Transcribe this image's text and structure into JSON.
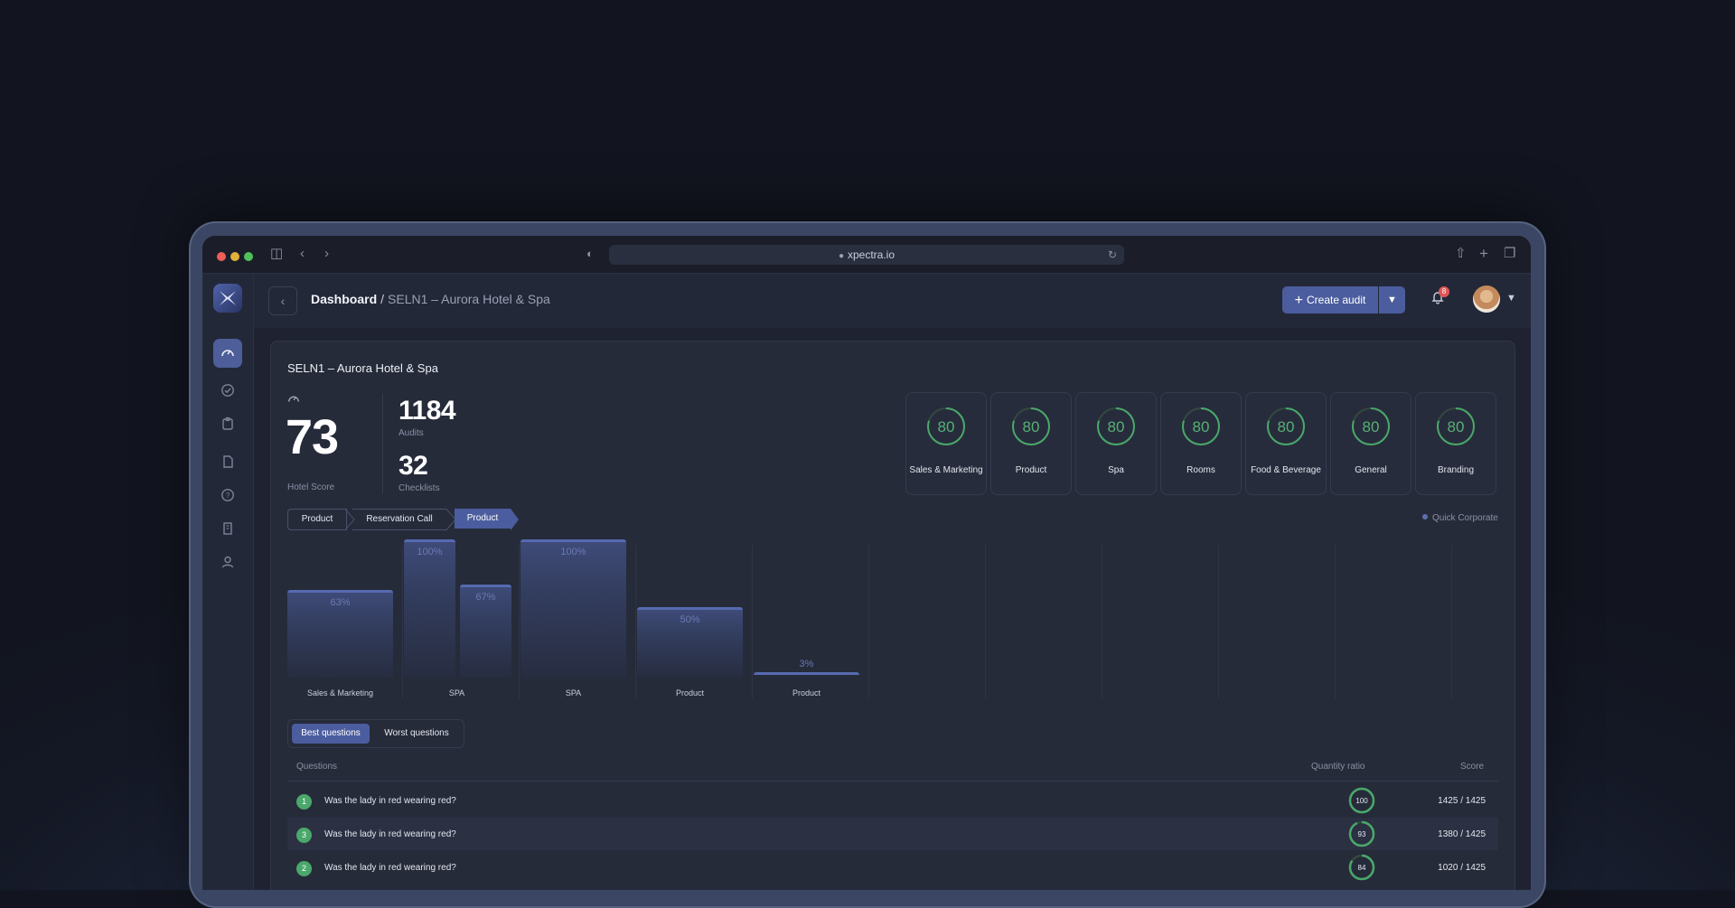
{
  "browser": {
    "url": "xpectra.io"
  },
  "breadcrumb": {
    "root": "Dashboard",
    "separator": "/",
    "current": "SELN1 – Aurora Hotel & Spa"
  },
  "header": {
    "create_label": "Create audit",
    "notification_count": "8"
  },
  "card": {
    "title": "SELN1 – Aurora Hotel & Spa",
    "hotel_score": "73",
    "hotel_score_label": "Hotel Score",
    "audits": "1184",
    "audits_label": "Audits",
    "checklists": "32",
    "checklists_label": "Checklists"
  },
  "categories": [
    {
      "name": "Sales & Marketing",
      "value": "80"
    },
    {
      "name": "Product",
      "value": "80"
    },
    {
      "name": "Spa",
      "value": "80"
    },
    {
      "name": "Rooms",
      "value": "80"
    },
    {
      "name": "Food & Beverage",
      "value": "80"
    },
    {
      "name": "General",
      "value": "80"
    },
    {
      "name": "Branding",
      "value": "80"
    }
  ],
  "steps": [
    "Product",
    "Reservation Call",
    "Product"
  ],
  "legend": "Quick Corporate",
  "chart_data": {
    "type": "bar",
    "categories": [
      "Sales & Marketing",
      "SPA",
      "SPA",
      "Product",
      "Product"
    ],
    "bars": [
      {
        "group": 0,
        "value": 63,
        "label": "63%"
      },
      {
        "group": 1,
        "value": 100,
        "label": "100%"
      },
      {
        "group": 1,
        "value": 67,
        "label": "67%"
      },
      {
        "group": 2,
        "value": 100,
        "label": "100%"
      },
      {
        "group": 3,
        "value": 50,
        "label": "50%"
      },
      {
        "group": 4,
        "value": 3,
        "label": "3%"
      }
    ],
    "ylim": [
      0,
      100
    ]
  },
  "tabs": {
    "best": "Best questions",
    "worst": "Worst questions"
  },
  "table": {
    "col_question": "Questions",
    "col_ratio": "Quantity ratio",
    "col_score": "Score",
    "rows": [
      {
        "rank": "1",
        "question": "Was the lady in red wearing red?",
        "ratio": 100,
        "score": "1425 / 1425"
      },
      {
        "rank": "3",
        "question": "Was the lady in red wearing red?",
        "ratio": 93,
        "score": "1380 / 1425"
      },
      {
        "rank": "2",
        "question": "Was the lady in red wearing red?",
        "ratio": 84,
        "score": "1020 / 1425"
      }
    ]
  },
  "colors": {
    "accent": "#4b5d9e",
    "good": "#4aa86a",
    "bar_top": "#566ab0"
  },
  "icons": {
    "sidebar": [
      "dashboard-gauge-icon",
      "check-circle-icon",
      "clipboard-icon",
      "document-icon",
      "help-icon",
      "building-icon",
      "user-icon"
    ]
  }
}
